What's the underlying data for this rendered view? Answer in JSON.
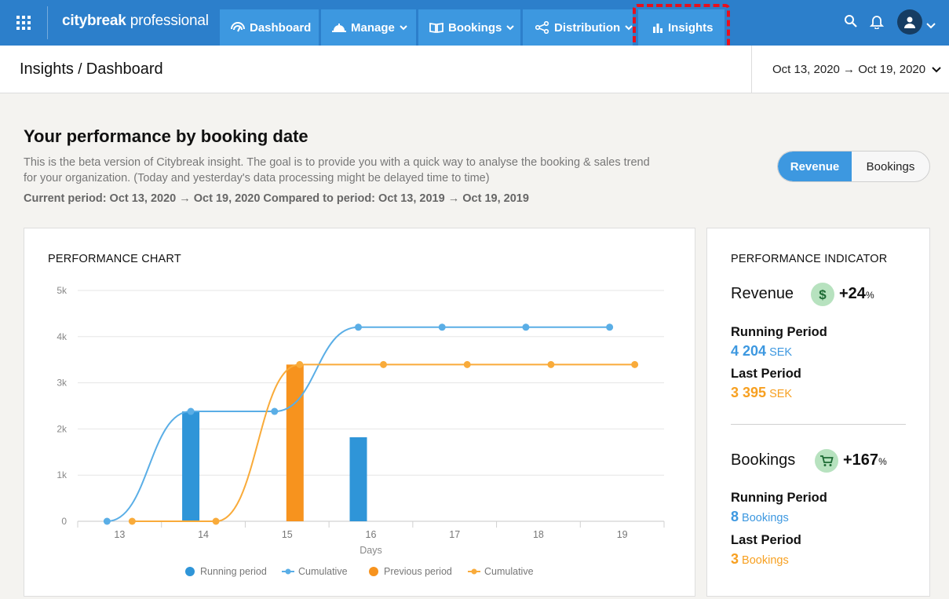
{
  "nav": {
    "brand_bold": "citybreak",
    "brand_light": " professional",
    "tabs": [
      {
        "label": "Dashboard"
      },
      {
        "label": "Manage"
      },
      {
        "label": "Bookings"
      },
      {
        "label": "Distribution"
      },
      {
        "label": "Insights"
      }
    ]
  },
  "header": {
    "title_section": "Insights",
    "title_separator": " / ",
    "title_page": "Dashboard",
    "date_range": "Oct 13, 2020 → Oct 19, 2020"
  },
  "intro": {
    "title": "Your performance by booking date",
    "description": "This is the beta version of Citybreak insight. The goal is to provide you with a quick way to analyse the booking & sales trend for your organization. (Today and yesterday's data processing might be delayed time to time)",
    "period_line": "Current period: Oct 13, 2020 → Oct 19, 2020 Compared to period: Oct 13, 2019 → Oct 19, 2019"
  },
  "toggle": {
    "revenue": "Revenue",
    "bookings": "Bookings"
  },
  "chart_card": {
    "title": "PERFORMANCE CHART"
  },
  "chart_data": {
    "type": "bar",
    "categories": [
      "13",
      "14",
      "15",
      "16",
      "17",
      "18",
      "19"
    ],
    "xlabel": "Days",
    "ylabel": "",
    "ylim": [
      0,
      5000
    ],
    "yticks": [
      "0",
      "1k",
      "2k",
      "3k",
      "4k",
      "5k"
    ],
    "grid": true,
    "legend_position": "bottom",
    "series": [
      {
        "name": "Running period",
        "kind": "bar",
        "color": "#2f95d8",
        "values": [
          0,
          2380,
          0,
          1820,
          0,
          0,
          0
        ]
      },
      {
        "name": "Cumulative",
        "kind": "line",
        "color": "#5aaee6",
        "values": [
          0,
          2380,
          2380,
          4204,
          4204,
          4204,
          4204
        ]
      },
      {
        "name": "Previous period",
        "kind": "bar",
        "color": "#f7931e",
        "values": [
          0,
          0,
          3395,
          0,
          0,
          0,
          0
        ]
      },
      {
        "name": "Cumulative",
        "kind": "line",
        "color": "#f9ab3a",
        "values": [
          0,
          0,
          3395,
          3395,
          3395,
          3395,
          3395
        ]
      }
    ]
  },
  "indicator_card": {
    "title": "PERFORMANCE INDICATOR",
    "revenue": {
      "name": "Revenue",
      "change": "+24",
      "change_unit": "%",
      "running_label": "Running Period",
      "running_value": "4 204",
      "running_unit": " SEK",
      "last_label": "Last Period",
      "last_value": "3 395",
      "last_unit": " SEK"
    },
    "bookings": {
      "name": "Bookings",
      "change": "+167",
      "change_unit": "%",
      "running_label": "Running Period",
      "running_value": "8",
      "running_unit": " Bookings",
      "last_label": "Last Period",
      "last_value": "3",
      "last_unit": " Bookings"
    }
  },
  "colors": {
    "nav_bg": "#2c7fcb",
    "nav_tab": "#3d98e0",
    "accent_blue": "#3d98e0",
    "accent_orange": "#f7a021",
    "highlight": "#e8101d"
  }
}
